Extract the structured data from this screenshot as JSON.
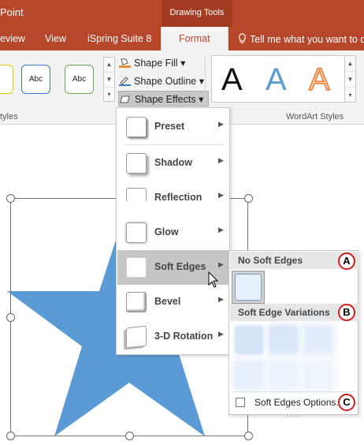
{
  "title_bar": {
    "app_title": "Point",
    "context_tab_title": "Drawing Tools"
  },
  "tabs": [
    {
      "label": "eview"
    },
    {
      "label": "View"
    },
    {
      "label": "iSpring Suite 8"
    },
    {
      "label": "Format",
      "active": true
    }
  ],
  "tell_me": {
    "label": "Tell me what you want to d",
    "icon": "lightbulb-icon"
  },
  "ribbon": {
    "shape_styles": {
      "sample_text": "Abc",
      "group_label": "tyles"
    },
    "commands": {
      "shape_fill": "Shape Fill",
      "shape_outline": "Shape Outline",
      "shape_effects": "Shape Effects"
    },
    "wordart": {
      "sample_letter": "A",
      "group_label": "WordArt Styles"
    }
  },
  "effects_menu": {
    "items": [
      {
        "label": "Preset"
      },
      {
        "label": "Shadow"
      },
      {
        "label": "Reflection"
      },
      {
        "label": "Glow"
      },
      {
        "label": "Soft Edges"
      },
      {
        "label": "Bevel"
      },
      {
        "label": "3-D Rotation"
      }
    ]
  },
  "soft_edges_submenu": {
    "no_soft_edges_header": "No Soft Edges",
    "variations_header": "Soft Edge Variations",
    "options_label": "Soft Edges Options...",
    "grip": "....."
  },
  "badges": {
    "a": "A",
    "b": "B",
    "c": "C"
  },
  "colors": {
    "ribbon_red": "#b7472a",
    "star_blue": "#5b9bd5",
    "badge_red": "#d01e1e",
    "menu_hover": "#c6c6c6"
  }
}
